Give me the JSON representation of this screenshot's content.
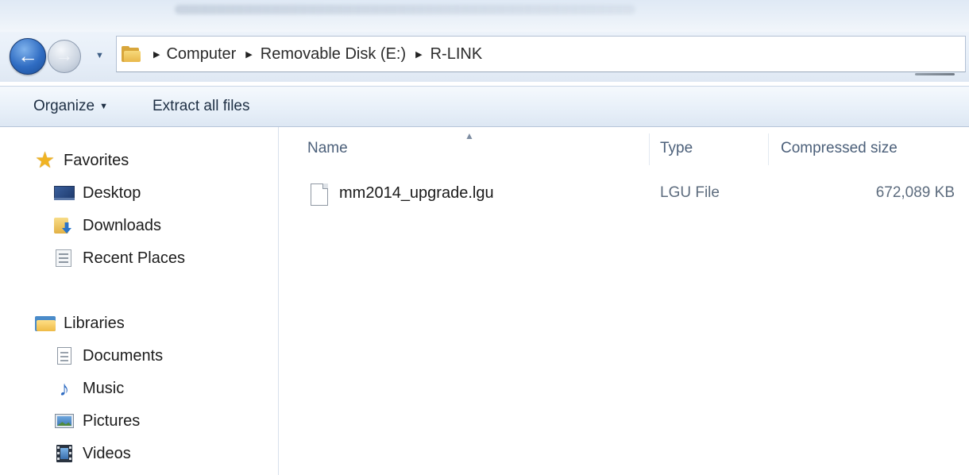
{
  "navigation": {
    "back_icon": "back-arrow-icon",
    "forward_icon": "forward-arrow-icon",
    "history_dropdown_icon": "chevron-down-icon"
  },
  "address_bar": {
    "folder_icon": "folder-icon",
    "breadcrumbs": [
      "Computer",
      "Removable Disk (E:)",
      "R-LINK"
    ]
  },
  "command_bar": {
    "organize_label": "Organize",
    "extract_label": "Extract all files"
  },
  "nav_pane": {
    "favorites": {
      "label": "Favorites",
      "icon": "star-icon",
      "items": [
        {
          "label": "Desktop",
          "icon": "desktop-icon"
        },
        {
          "label": "Downloads",
          "icon": "downloads-folder-icon"
        },
        {
          "label": "Recent Places",
          "icon": "recent-places-icon"
        }
      ]
    },
    "libraries": {
      "label": "Libraries",
      "icon": "libraries-icon",
      "items": [
        {
          "label": "Documents",
          "icon": "documents-icon"
        },
        {
          "label": "Music",
          "icon": "music-note-icon"
        },
        {
          "label": "Pictures",
          "icon": "pictures-icon"
        },
        {
          "label": "Videos",
          "icon": "videos-icon"
        }
      ]
    }
  },
  "file_list": {
    "columns": [
      "Name",
      "Type",
      "Compressed size"
    ],
    "sorted_by": "Name",
    "rows": [
      {
        "name": "mm2014_upgrade.lgu",
        "type": "LGU File",
        "compressed_size": "672,089 KB",
        "icon": "file-icon"
      }
    ]
  },
  "colors": {
    "accent_blue": "#2f6cc2",
    "command_bar_bg": "#e8f0f9",
    "header_text": "#4c607a"
  }
}
